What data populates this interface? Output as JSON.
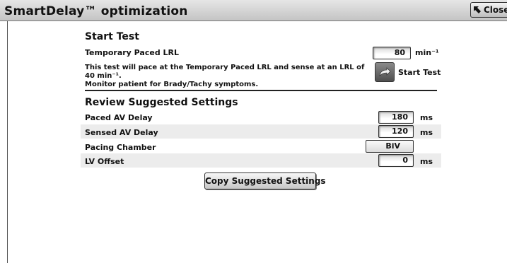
{
  "window": {
    "title": "SmartDelay™ optimization",
    "close_label": "Close"
  },
  "start_test": {
    "heading": "Start Test",
    "temp_lrl_label": "Temporary Paced LRL",
    "temp_lrl_value": "80",
    "temp_lrl_unit": "min⁻¹",
    "description_line1": "This test will pace at the Temporary Paced LRL and sense at an LRL of 40 min⁻¹.",
    "description_line2": "Monitor patient for Brady/Tachy symptoms.",
    "start_button_label": "Start Test"
  },
  "review": {
    "heading": "Review Suggested Settings",
    "rows": [
      {
        "label": "Paced AV Delay",
        "value": "180",
        "unit": "ms"
      },
      {
        "label": "Sensed AV Delay",
        "value": "120",
        "unit": "ms"
      },
      {
        "label": "Pacing Chamber",
        "value": "BiV",
        "unit": ""
      },
      {
        "label": "LV Offset",
        "value": "0",
        "unit": "ms"
      }
    ],
    "copy_button_label": "Copy Suggested Settings"
  },
  "icons": {
    "close": "arrow-up-left-icon",
    "start": "curved-arrow-icon"
  }
}
